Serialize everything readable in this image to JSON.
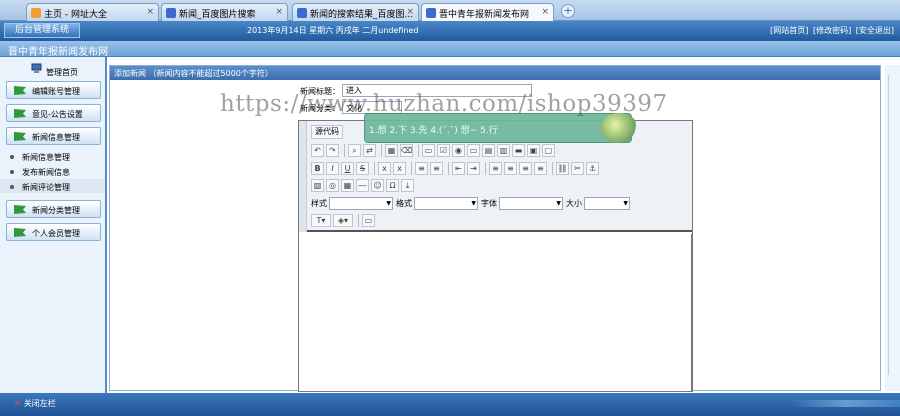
{
  "browser": {
    "tabs": [
      {
        "label": "主页 - 网址大全",
        "icon_color": "#f0a030"
      },
      {
        "label": "新闻_百度图片搜索",
        "icon_color": "#3a6bd0"
      },
      {
        "label": "新闻的搜索结果_百度图...",
        "icon_color": "#3a6bd0"
      },
      {
        "label": "晋中青年报新闻发布网",
        "icon_color": "#3a6bd0"
      }
    ],
    "close_glyph": "×",
    "new_tab_glyph": "+"
  },
  "header": {
    "logo": "后台管理系统",
    "date": "2013年9月14日 星期六 丙戌年 二月undefined",
    "links": [
      "[网站首页]",
      "[修改密码]",
      "[安全退出]"
    ]
  },
  "site_title": "晋中青年报新闻发布网",
  "sidebar": {
    "home": "管理首页",
    "menus": [
      "编辑账号管理",
      "意见-公告设置",
      "新闻信息管理",
      "新闻分类管理",
      "个人会员管理"
    ],
    "sub_items": [
      "新闻信息管理",
      "发布新闻信息",
      "新闻评论管理"
    ]
  },
  "content": {
    "heading": "添加新闻 （新闻内容不能超过5000个字符）",
    "title_label": "新闻标题：",
    "title_value": "进入",
    "category_label": "新闻分类：",
    "category_value": "文化"
  },
  "editor": {
    "source_button": "源代码",
    "style_label": "样式",
    "format_label": "格式",
    "font_label": "字体",
    "size_label": "大小"
  },
  "ime": {
    "candidates": "1.想 2.下 3.先 4.(¯.¯) 想~ 5.行"
  },
  "watermark": "https://www.huzhan.com/ishop39397",
  "footer": {
    "close_nav": "关闭左栏"
  },
  "colors": {
    "header": "#215b9e",
    "sidebar_bg": "#eaf2fb",
    "menu_flag": "#2e9a3a",
    "ime_bg": "#6db89b"
  }
}
